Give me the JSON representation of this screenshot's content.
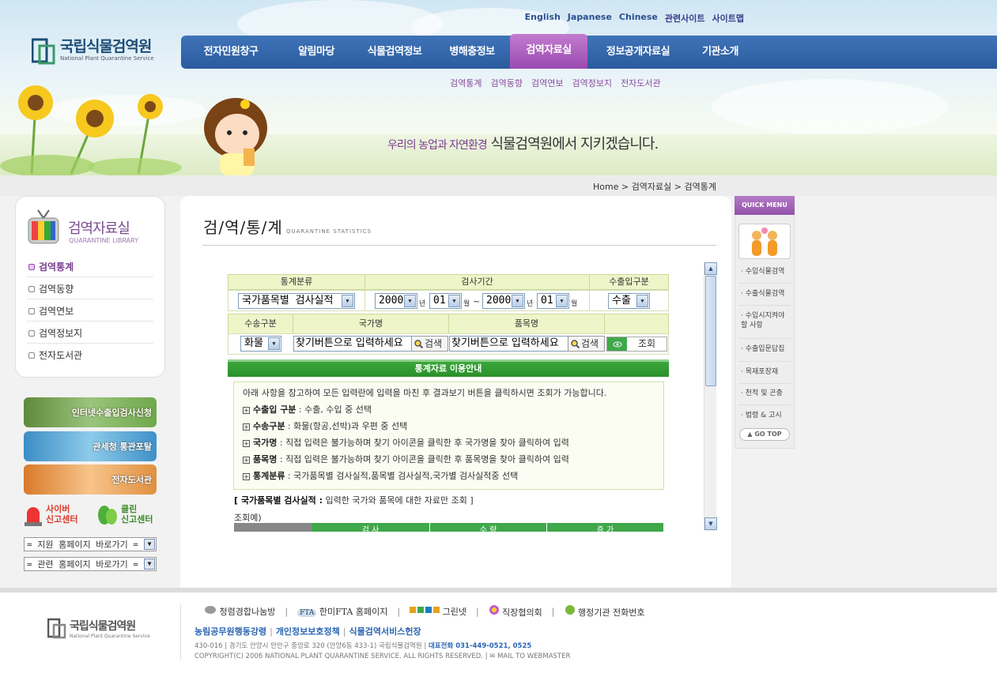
{
  "header": {
    "top_links": [
      "English",
      "Japanese",
      "Chinese",
      "관련사이트",
      "사이트맵"
    ],
    "logo_ko": "국립식물검역원",
    "logo_en": "National Plant Quarantine Service",
    "gnb": [
      {
        "label": "전자민원창구",
        "active": false
      },
      {
        "label": "알림마당",
        "active": false
      },
      {
        "label": "식물검역정보",
        "active": false
      },
      {
        "label": "병해충정보",
        "active": false
      },
      {
        "label": "검역자료실",
        "active": true
      },
      {
        "label": "정보공개자료실",
        "active": false
      },
      {
        "label": "기관소개",
        "active": false
      }
    ],
    "subnav": [
      "검역통계",
      "검역동향",
      "검역연보",
      "검역정보지",
      "전자도서관"
    ],
    "slogan_a": "우리의 농업과 자연환경",
    "slogan_b": "식물검역원에서 지키겠습니다."
  },
  "breadcrumb": [
    "Home",
    "검역자료실",
    "검역통계"
  ],
  "lnb": {
    "title": "검역자료실",
    "subtitle": "QUARANTINE LIBRARY",
    "items": [
      {
        "label": "검역통계",
        "active": true
      },
      {
        "label": "검역동향",
        "active": false
      },
      {
        "label": "검역연보",
        "active": false
      },
      {
        "label": "검역정보지",
        "active": false
      },
      {
        "label": "전자도서관",
        "active": false
      }
    ],
    "banners": [
      "인터넷수출입검사신청",
      "관세청 통관포탈",
      "전자도서관"
    ],
    "cyber": [
      "사이버",
      "신고센터"
    ],
    "clean": [
      "클린",
      "신고센터"
    ],
    "select1": "= 지원 홈페이지 바로가기 =",
    "select2": "= 관련 홈페이지 바로가기 ="
  },
  "page": {
    "title": "검/역/통/계",
    "title_en": "QUARANTINE STATISTICS"
  },
  "form": {
    "h_category": "통계분류",
    "h_period": "검사기간",
    "h_inout": "수출입구분",
    "category_value": "국가품목별 검사실적",
    "from_year": "2000",
    "from_month": "01",
    "to_year": "2000",
    "to_month": "01",
    "unit_year": "년",
    "unit_month": "월",
    "tilde": "~",
    "inout_value": "수출",
    "h_transport": "수송구분",
    "h_country": "국가명",
    "h_item": "품목명",
    "transport_value": "화물",
    "country_value": "찾기버튼으로 입력하세요",
    "item_value": "찾기버튼으로 입력하세요",
    "search_label": "검색",
    "query_label": "조회"
  },
  "guide": {
    "bar": "통계자료 이용안내",
    "intro": "아래 사항을 참고하여 모든 입력란에 입력을 마친 후 결과보기 버튼을 클릭하시면 조회가 가능합니다.",
    "items": [
      {
        "term": "수출입 구분",
        "desc": " : 수출, 수입 중 선택"
      },
      {
        "term": "수송구분",
        "desc": " : 화물(항공,선박)과 우편 중 선택"
      },
      {
        "term": "국가명",
        "desc": " : 직접 입력은 불가능하며 찾기 아이콘을 클릭한 후 국가명을 찾아 클릭하여 입력"
      },
      {
        "term": "품목명",
        "desc": " : 직접 입력은 불가능하며 찾기 아이콘을 클릭한 후 품목명을 찾아 클릭하여 입력"
      },
      {
        "term": "통계분류",
        "desc": " : 국가품목별 검사실적,품목별 검사실적,국가별 검사실적중 선택"
      }
    ],
    "note_term": "[ 국가품목별 검사실적 :",
    "note_desc": " 입력한 국가와 품목에 대한 자료만 조회 ]",
    "example": "조회예)",
    "example_heads": [
      "검 사",
      "수 량",
      "증 가"
    ]
  },
  "quick": {
    "title": "QUICK MENU",
    "items": [
      "수입식물검역",
      "수출식물검역",
      "수입시지켜야 할 사항",
      "수출입문답집",
      "목재포장재",
      "천적 및 곤충",
      "법령 & 고시"
    ],
    "gotop": "GO TOP"
  },
  "footer": {
    "logo_ko": "국립식물검역원",
    "logo_en": "National Plant Quarantine Service",
    "links": [
      "청렴경합나눔방",
      "한미FTA 홈페이지",
      "그린넷",
      "직장협의회",
      "행정기관 전화번호"
    ],
    "fta_badge": "FTA",
    "policies": [
      "농림공무원행동강령",
      "개인정보보호정책",
      "식물검역서비스헌장"
    ],
    "address": "430-016 | 경기도 안양시 만안구 중앙로 320 (안양6동 433-1) 국립식물검역원",
    "phone_label": "대표전화 031-449-0521, 0525",
    "copyright": "COPYRIGHT(C) 2006 NATIONAL PLANT QUARANTINE SERVICE. ALL RIGHTS RESERVED. |",
    "webmaster": "MAIL TO WEBMASTER"
  }
}
